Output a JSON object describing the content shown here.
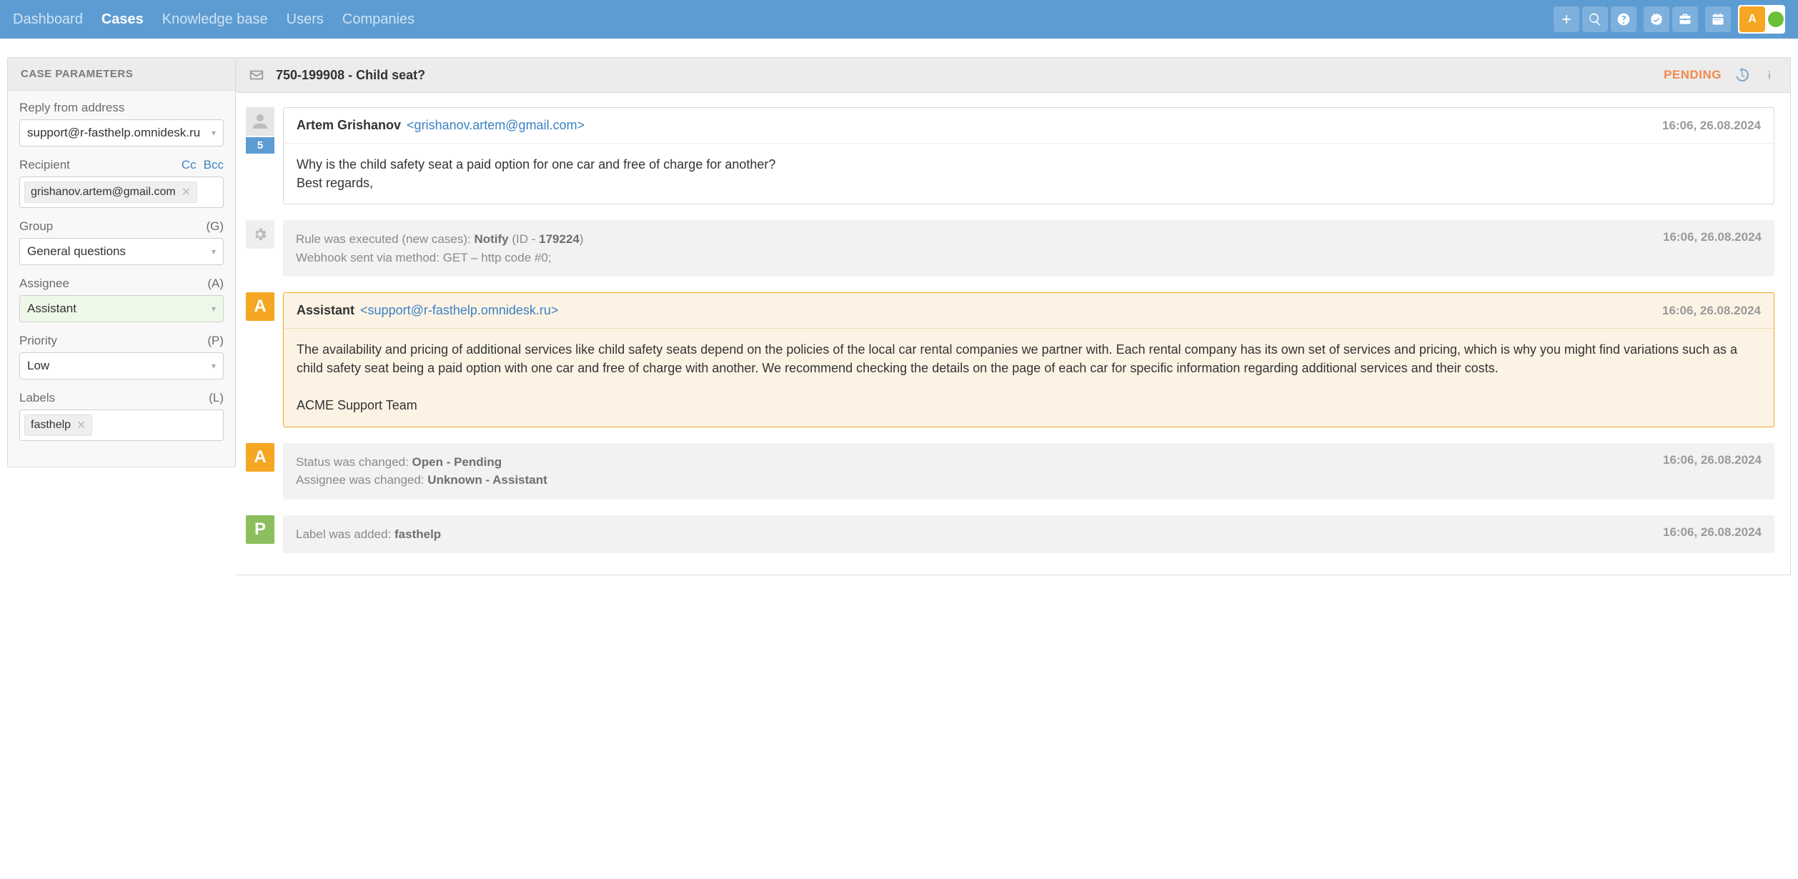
{
  "nav": {
    "items": [
      {
        "label": "Dashboard",
        "active": false
      },
      {
        "label": "Cases",
        "active": true
      },
      {
        "label": "Knowledge base",
        "active": false
      },
      {
        "label": "Users",
        "active": false
      },
      {
        "label": "Companies",
        "active": false
      }
    ],
    "user_initial": "A"
  },
  "sidebar": {
    "header": "CASE PARAMETERS",
    "reply_from": {
      "label": "Reply from address",
      "value": "support@r-fasthelp.omnidesk.ru"
    },
    "recipient": {
      "label": "Recipient",
      "cc": "Cc",
      "bcc": "Bcc",
      "chip": "grishanov.artem@gmail.com"
    },
    "group": {
      "label": "Group",
      "hint": "(G)",
      "value": "General questions"
    },
    "assignee": {
      "label": "Assignee",
      "hint": "(A)",
      "value": "Assistant"
    },
    "priority": {
      "label": "Priority",
      "hint": "(P)",
      "value": "Low"
    },
    "labels": {
      "label": "Labels",
      "hint": "(L)",
      "chip": "fasthelp"
    }
  },
  "header": {
    "title": "750-199908 - Child seat?",
    "status": "PENDING"
  },
  "timeline": {
    "msg1": {
      "name": "Artem Grishanov",
      "email": "<grishanov.artem@gmail.com>",
      "ts": "16:06, 26.08.2024",
      "count": "5",
      "body": "Why is the child safety seat a paid option for one car and free of charge for another?\nBest regards,"
    },
    "sys1": {
      "line1a": "Rule was executed (new cases): ",
      "line1b": "Notify",
      "line1c": " (ID - ",
      "line1d": "179224",
      "line1e": ")",
      "line2": "Webhook sent via method: GET – http code #0;",
      "ts": "16:06, 26.08.2024"
    },
    "msg2": {
      "initial": "A",
      "name": "Assistant",
      "email": "<support@r-fasthelp.omnidesk.ru>",
      "ts": "16:06, 26.08.2024",
      "body": "The availability and pricing of additional services like child safety seats depend on the policies of the local car rental companies we partner with. Each rental company has its own set of services and pricing, which is why you might find variations such as a child safety seat being a paid option with one car and free of charge with another. We recommend checking the details on the page of each car for specific information regarding additional services and their costs.\n\nACME Support Team"
    },
    "sys2": {
      "initial": "A",
      "l1a": "Status was changed: ",
      "l1b": "Open - Pending",
      "l2a": "Assignee was changed: ",
      "l2b": "Unknown - Assistant",
      "ts": "16:06, 26.08.2024"
    },
    "sys3": {
      "initial": "P",
      "l1a": "Label was added: ",
      "l1b": "fasthelp",
      "ts": "16:06, 26.08.2024"
    }
  }
}
